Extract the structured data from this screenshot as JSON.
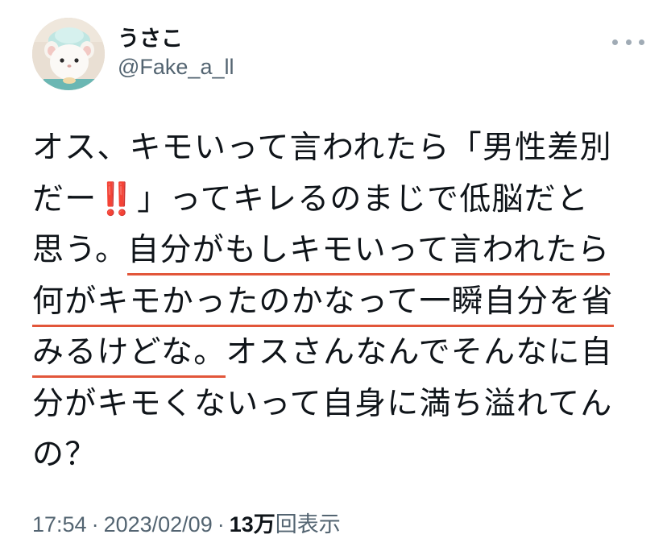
{
  "user": {
    "display_name": "うさこ",
    "handle": "@Fake_a_ll"
  },
  "tweet": {
    "segments": {
      "l1": "オス、キモいって言われたら「男性差別",
      "l2a": "だー",
      "l2_emoji": "‼️",
      "l2b": "」ってキレるのまじで低脳だと",
      "l3a": "思う。",
      "l3b": "自分がもしキモいって言われたら",
      "l4": "何がキモかったのかなって一瞬自分を省",
      "l5a": "みるけどな。",
      "l5b": "オスさんなんでそんなに自",
      "l6": "分がキモくないって自身に満ち溢れてん",
      "l7": "の？"
    },
    "underline_color": "#e2563a"
  },
  "meta": {
    "time": "17:54",
    "separator": "·",
    "date": "2023/02/09",
    "views_count": "13万",
    "views_label": "回表示"
  },
  "colors": {
    "text": "#0f1419",
    "secondary": "#536471",
    "more_dots": "#a0abb5"
  },
  "icons": {
    "more": "more-horizontal-icon",
    "avatar": "avatar"
  }
}
